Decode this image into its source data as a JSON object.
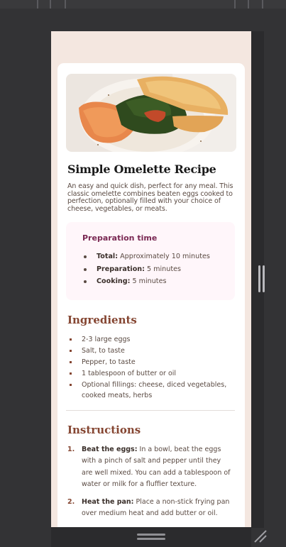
{
  "recipe": {
    "title": "Simple Omelette Recipe",
    "intro": "An easy and quick dish, perfect for any meal. This classic omelette combines beaten eggs cooked to perfection, optionally filled with your choice of cheese, vegetables, or meats."
  },
  "preparation": {
    "title": "Preparation time",
    "items": [
      {
        "label": "Total:",
        "value": " Approximately 10 minutes"
      },
      {
        "label": "Preparation:",
        "value": " 5 minutes"
      },
      {
        "label": "Cooking:",
        "value": " 5 minutes"
      }
    ]
  },
  "ingredients": {
    "title": "Ingredients",
    "items": [
      "2-3 large eggs",
      "Salt, to taste",
      "Pepper, to taste",
      "1 tablespoon of butter or oil",
      "Optional fillings: cheese, diced vegetables, cooked meats, herbs"
    ]
  },
  "instructions": {
    "title": "Instructions",
    "steps": [
      {
        "num": "1.",
        "label": "Beat the eggs:",
        "text": " In a bowl, beat the eggs with a pinch of salt and pepper until they are well mixed. You can add a tablespoon of water or milk for a fluffier texture."
      },
      {
        "num": "2.",
        "label": "Heat the pan:",
        "text": " Place a non-stick frying pan over medium heat and add butter or oil."
      }
    ]
  },
  "colors": {
    "page_background": "#f4e7e0",
    "heading_accent": "#854632",
    "prep_accent": "#7a2853",
    "prep_background": "#fff6fa",
    "editor_background": "#333335"
  },
  "icons": {
    "hero": "omelette-photo",
    "resize_vertical": "resize-handle-vertical-icon",
    "resize_horizontal": "resize-handle-horizontal-icon",
    "corner": "resize-corner-icon"
  }
}
